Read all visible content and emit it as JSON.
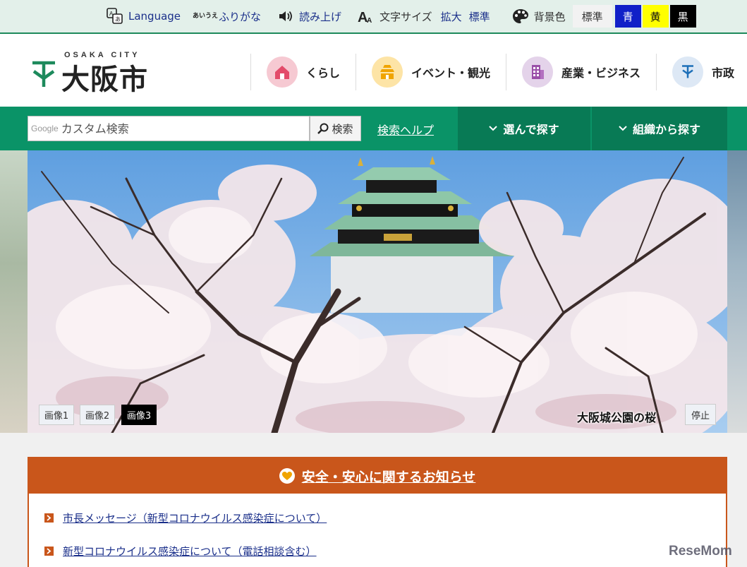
{
  "utility": {
    "language": "Language",
    "furigana": "ふりがな",
    "furigana_icon_text": "あいうえ",
    "read_aloud": "読み上げ",
    "text_size_label": "文字サイズ",
    "text_size_enlarge": "拡大",
    "text_size_standard": "標準",
    "bg_color_label": "背景色",
    "bg_standard": "標準",
    "bg_blue": "青",
    "bg_yellow": "黄",
    "bg_black": "黒",
    "colors": {
      "blue": "#1020c8",
      "yellow": "#ffff00",
      "black": "#000000"
    }
  },
  "header": {
    "logo_sub": "OSAKA CITY",
    "logo_name": "大阪市",
    "categories": [
      {
        "label": "くらし",
        "icon": "house-icon",
        "color": "#f6c9d2"
      },
      {
        "label": "イベント・観光",
        "icon": "castle-icon",
        "color": "#fde4a6"
      },
      {
        "label": "産業・ビジネス",
        "icon": "building-icon",
        "color": "#e4d3ea"
      },
      {
        "label": "市政",
        "icon": "city-emblem-icon",
        "color": "#dde8f5"
      }
    ]
  },
  "nav": {
    "search_google": "Google",
    "search_placeholder": "カスタム検索",
    "search_button": "検索",
    "search_help": "検索ヘルプ",
    "browse": "選んで探す",
    "by_org": "組織から探す",
    "accent": "#0a9367"
  },
  "hero": {
    "slides": [
      "画像1",
      "画像2",
      "画像3"
    ],
    "active_slide": 3,
    "caption": "大阪城公園の桜",
    "stop": "停止"
  },
  "notice": {
    "title": "安全・安心に関するお知らせ",
    "accent": "#c9561b",
    "items": [
      "市長メッセージ（新型コロナウイルス感染症について）",
      "新型コロナウイルス感染症について（電話相談含む）"
    ]
  },
  "watermark": "ReseMom"
}
